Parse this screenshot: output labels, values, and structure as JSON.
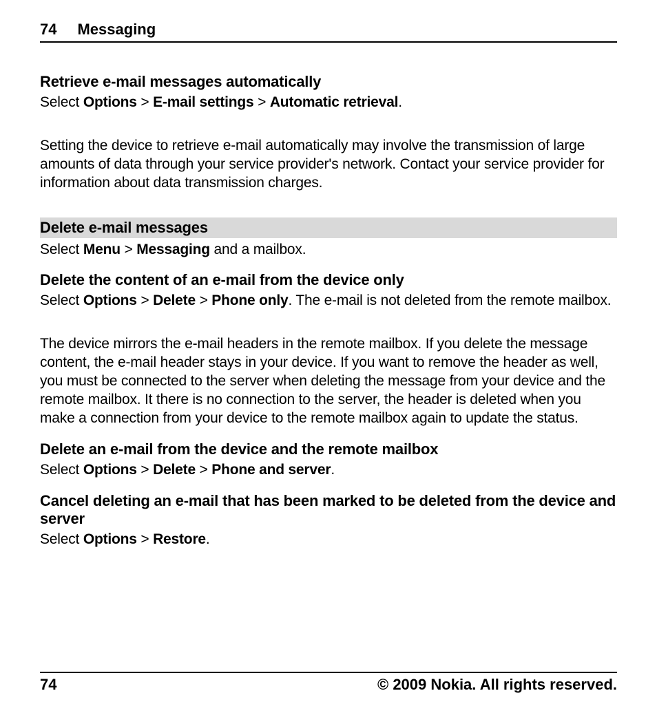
{
  "header": {
    "page_number": "74",
    "chapter": "Messaging"
  },
  "sections": {
    "retrieve": {
      "title": "Retrieve e-mail messages automatically",
      "select": "Select ",
      "opt": "Options",
      "sep1": "  > ",
      "set": "E-mail settings",
      "sep2": "  > ",
      "auto": "Automatic retrieval",
      "dot": ".",
      "body": "Setting the device to retrieve e-mail automatically may involve the transmission of large amounts of data through your service provider's network. Contact your service provider for information about data transmission charges."
    },
    "delete_head": {
      "title": "Delete e-mail messages",
      "select": "Select ",
      "menu": "Menu",
      "sep1": "  > ",
      "msg": "Messaging",
      "tail": " and a mailbox."
    },
    "device_only": {
      "title": "Delete the content of an e-mail from the device only",
      "select": "Select ",
      "opt": "Options",
      "sep1": "  > ",
      "del": "Delete",
      "sep2": "  > ",
      "phone": "Phone only",
      "tail": ". The e-mail is not deleted from the remote mailbox.",
      "body": "The device mirrors the e-mail headers in the remote mailbox. If you delete the message content, the e-mail header stays in your device. If you want to remove the header as well, you must be connected to the server when deleting the message from your device and the remote mailbox. It there is no connection to the server, the header is deleted when you make a connection from your device to the remote mailbox again to update the status."
    },
    "device_remote": {
      "title": "Delete an e-mail from the device and the remote mailbox",
      "select": "Select ",
      "opt": "Options",
      "sep1": "  > ",
      "del": "Delete",
      "sep2": "  > ",
      "ps": "Phone and server",
      "dot": "."
    },
    "cancel": {
      "title": "Cancel deleting an e-mail that has been marked to be deleted from the device and server",
      "select": "Select ",
      "opt": "Options",
      "sep1": "  > ",
      "res": "Restore",
      "dot": "."
    }
  },
  "footer": {
    "page_number": "74",
    "copyright": "© 2009 Nokia. All rights reserved."
  }
}
